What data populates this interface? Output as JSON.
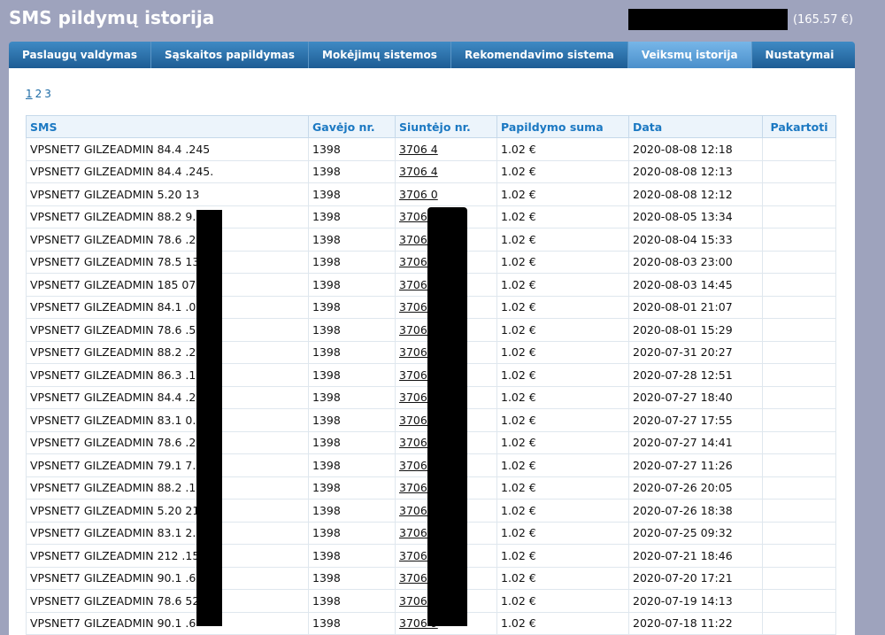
{
  "header": {
    "title": "SMS pildymų istorija",
    "balance": "(165.57 €)"
  },
  "nav": {
    "tabs": [
      {
        "label": "Paslaugų valdymas",
        "active": false
      },
      {
        "label": "Sąskaitos papildymas",
        "active": false
      },
      {
        "label": "Mokėjimų sistemos",
        "active": false
      },
      {
        "label": "Rekomendavimo sistema",
        "active": false
      },
      {
        "label": "Veiksmų istorija",
        "active": true
      },
      {
        "label": "Nustatymai",
        "active": false
      }
    ]
  },
  "pager": {
    "pages": [
      "1",
      "2",
      "3"
    ],
    "current": "1"
  },
  "table": {
    "headers": {
      "sms": "SMS",
      "recipient": "Gavėjo nr.",
      "sender": "Siuntėjo nr.",
      "amount": "Papildymo suma",
      "date": "Data",
      "repeat": "Pakartoti"
    },
    "rows": [
      {
        "sms": "VPSNET7 GILZEADMIN 84.4        .245",
        "recipient": "1398",
        "sender": "3706         4",
        "amount": "1.02 €",
        "date": "2020-08-08 12:18"
      },
      {
        "sms": "VPSNET7 GILZEADMIN 84.4        .245.",
        "recipient": "1398",
        "sender": "3706         4",
        "amount": "1.02 €",
        "date": "2020-08-08 12:13"
      },
      {
        "sms": "VPSNET7 GILZEADMIN 5.20        13",
        "recipient": "1398",
        "sender": "3706         0",
        "amount": "1.02 €",
        "date": "2020-08-08 12:12"
      },
      {
        "sms": "VPSNET7 GILZEADMIN 88.2        9.71",
        "recipient": "1398",
        "sender": "3706         2",
        "amount": "1.02 €",
        "date": "2020-08-05 13:34"
      },
      {
        "sms": "VPSNET7 GILZEADMIN 78.6        .245",
        "recipient": "1398",
        "sender": "3706         7",
        "amount": "1.02 €",
        "date": "2020-08-04 15:33"
      },
      {
        "sms": "VPSNET7 GILZEADMIN 78.5        130",
        "recipient": "1398",
        "sender": "3706         4",
        "amount": "1.02 €",
        "date": "2020-08-03 23:00"
      },
      {
        "sms": "VPSNET7 GILZEADMIN 185        07.112",
        "recipient": "1398",
        "sender": "3706         5",
        "amount": "1.02 €",
        "date": "2020-08-03 14:45"
      },
      {
        "sms": "VPSNET7 GILZEADMIN 84.1        .0",
        "recipient": "1398",
        "sender": "3706         2",
        "amount": "1.02 €",
        "date": "2020-08-01 21:07"
      },
      {
        "sms": "VPSNET7 GILZEADMIN 78.6        .50",
        "recipient": "1398",
        "sender": "3706         5",
        "amount": "1.02 €",
        "date": "2020-08-01 15:29"
      },
      {
        "sms": "VPSNET7 GILZEADMIN 88.2        .244",
        "recipient": "1398",
        "sender": "3706         6",
        "amount": "1.02 €",
        "date": "2020-07-31 20:27"
      },
      {
        "sms": "VPSNET7 GILZEADMIN 86.3        .150",
        "recipient": "1398",
        "sender": "3706         4",
        "amount": "1.02 €",
        "date": "2020-07-28 12:51"
      },
      {
        "sms": "VPSNET7 GILZEADMIN 84.4        .245",
        "recipient": "1398",
        "sender": "3706         4",
        "amount": "1.02 €",
        "date": "2020-07-27 18:40"
      },
      {
        "sms": "VPSNET7 GILZEADMIN 83.1        0.186",
        "recipient": "1398",
        "sender": "3706         9",
        "amount": "1.02 €",
        "date": "2020-07-27 17:55"
      },
      {
        "sms": "VPSNET7 GILZEADMIN 78.6        .222",
        "recipient": "1398",
        "sender": "3706         2",
        "amount": "1.02 €",
        "date": "2020-07-27 14:41"
      },
      {
        "sms": "VPSNET7 GILZEADMIN 79.1        7.39",
        "recipient": "1398",
        "sender": "3706         0",
        "amount": "1.02 €",
        "date": "2020-07-27 11:26"
      },
      {
        "sms": "VPSNET7 GILZEADMIN 88.2        .103",
        "recipient": "1398",
        "sender": "3706         0",
        "amount": "1.02 €",
        "date": "2020-07-26 20:05"
      },
      {
        "sms": "VPSNET7 GILZEADMIN 5.20        215",
        "recipient": "1398",
        "sender": "3706         1",
        "amount": "1.02 €",
        "date": "2020-07-26 18:38"
      },
      {
        "sms": "VPSNET7 GILZEADMIN 83.1        2.184",
        "recipient": "1398",
        "sender": "3706         3",
        "amount": "1.02 €",
        "date": "2020-07-25 09:32"
      },
      {
        "sms": "VPSNET7 GILZEADMIN 212        .157",
        "recipient": "1398",
        "sender": "3706         4",
        "amount": "1.02 €",
        "date": "2020-07-21 18:46"
      },
      {
        "sms": "VPSNET7 GILZEADMIN 90.1        .6",
        "recipient": "1398",
        "sender": "3706         9",
        "amount": "1.02 €",
        "date": "2020-07-20 17:21"
      },
      {
        "sms": "VPSNET7 GILZEADMIN 78.6        52",
        "recipient": "1398",
        "sender": "3706         4",
        "amount": "1.02 €",
        "date": "2020-07-19 14:13"
      },
      {
        "sms": "VPSNET7 GILZEADMIN 90.1        .6",
        "recipient": "1398",
        "sender": "3706         9",
        "amount": "1.02 €",
        "date": "2020-07-18 11:22"
      }
    ]
  }
}
